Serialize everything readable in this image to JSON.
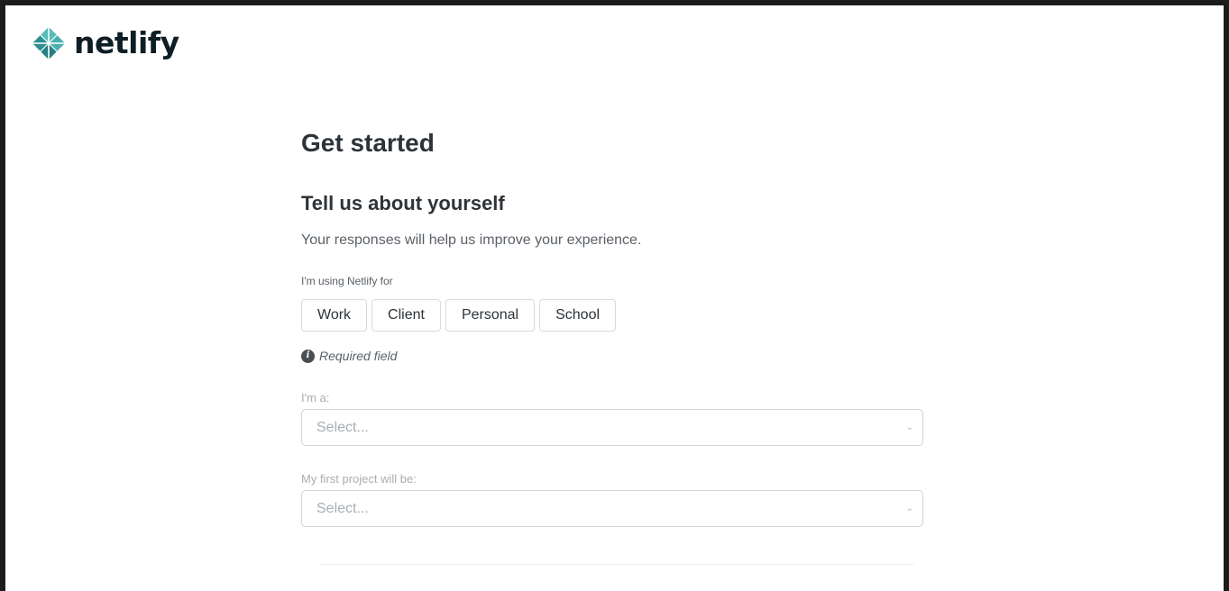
{
  "brand": {
    "name": "netlify",
    "logo_icon": "netlify-diamond-icon",
    "accent": "#3ca5a4"
  },
  "page": {
    "title": "Get started",
    "section_title": "Tell us about yourself",
    "subtitle": "Your responses will help us improve your experience."
  },
  "usage": {
    "label": "I'm using Netlify for",
    "options": [
      "Work",
      "Client",
      "Personal",
      "School"
    ]
  },
  "required": {
    "icon": "info-icon",
    "text": "Required field"
  },
  "fields": [
    {
      "label": "I'm a:",
      "placeholder": "Select...",
      "icon": "chevron-down-icon"
    },
    {
      "label": "My first project will be:",
      "placeholder": "Select...",
      "icon": "chevron-down-icon"
    }
  ]
}
